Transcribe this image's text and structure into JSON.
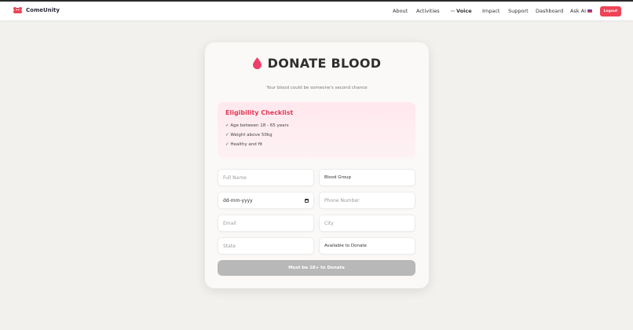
{
  "brand": {
    "name": "ComeUnity"
  },
  "nav": {
    "links": [
      "About",
      "Activities",
      "Voice",
      "Impact",
      "Support",
      "Dashboard",
      "Ask AI"
    ],
    "logout_label": "Logout"
  },
  "page": {
    "title": "DONATE BLOOD",
    "subtitle": "Your blood could be someone's second chance"
  },
  "checklist": {
    "title": "Eligibility Checklist",
    "items": [
      "✓ Age between 18 - 65 years",
      "✓ Weight above 50kg",
      "✓ Healthy and fit"
    ]
  },
  "form": {
    "full_name_placeholder": "Full Name",
    "blood_group_value": "Blood Group",
    "date_value": "dd-mm-yyyy",
    "phone_placeholder": "Phone Number",
    "email_placeholder": "Email",
    "city_placeholder": "City",
    "state_placeholder": "State",
    "availability_value": "Available to Donate",
    "submit_label": "Must be 18+ to Donate"
  },
  "colors": {
    "accent": "#ee4455",
    "checklist_title": "#e23a58",
    "drop": "#ec3f6a",
    "submit_disabled": "#b8b8b8"
  }
}
